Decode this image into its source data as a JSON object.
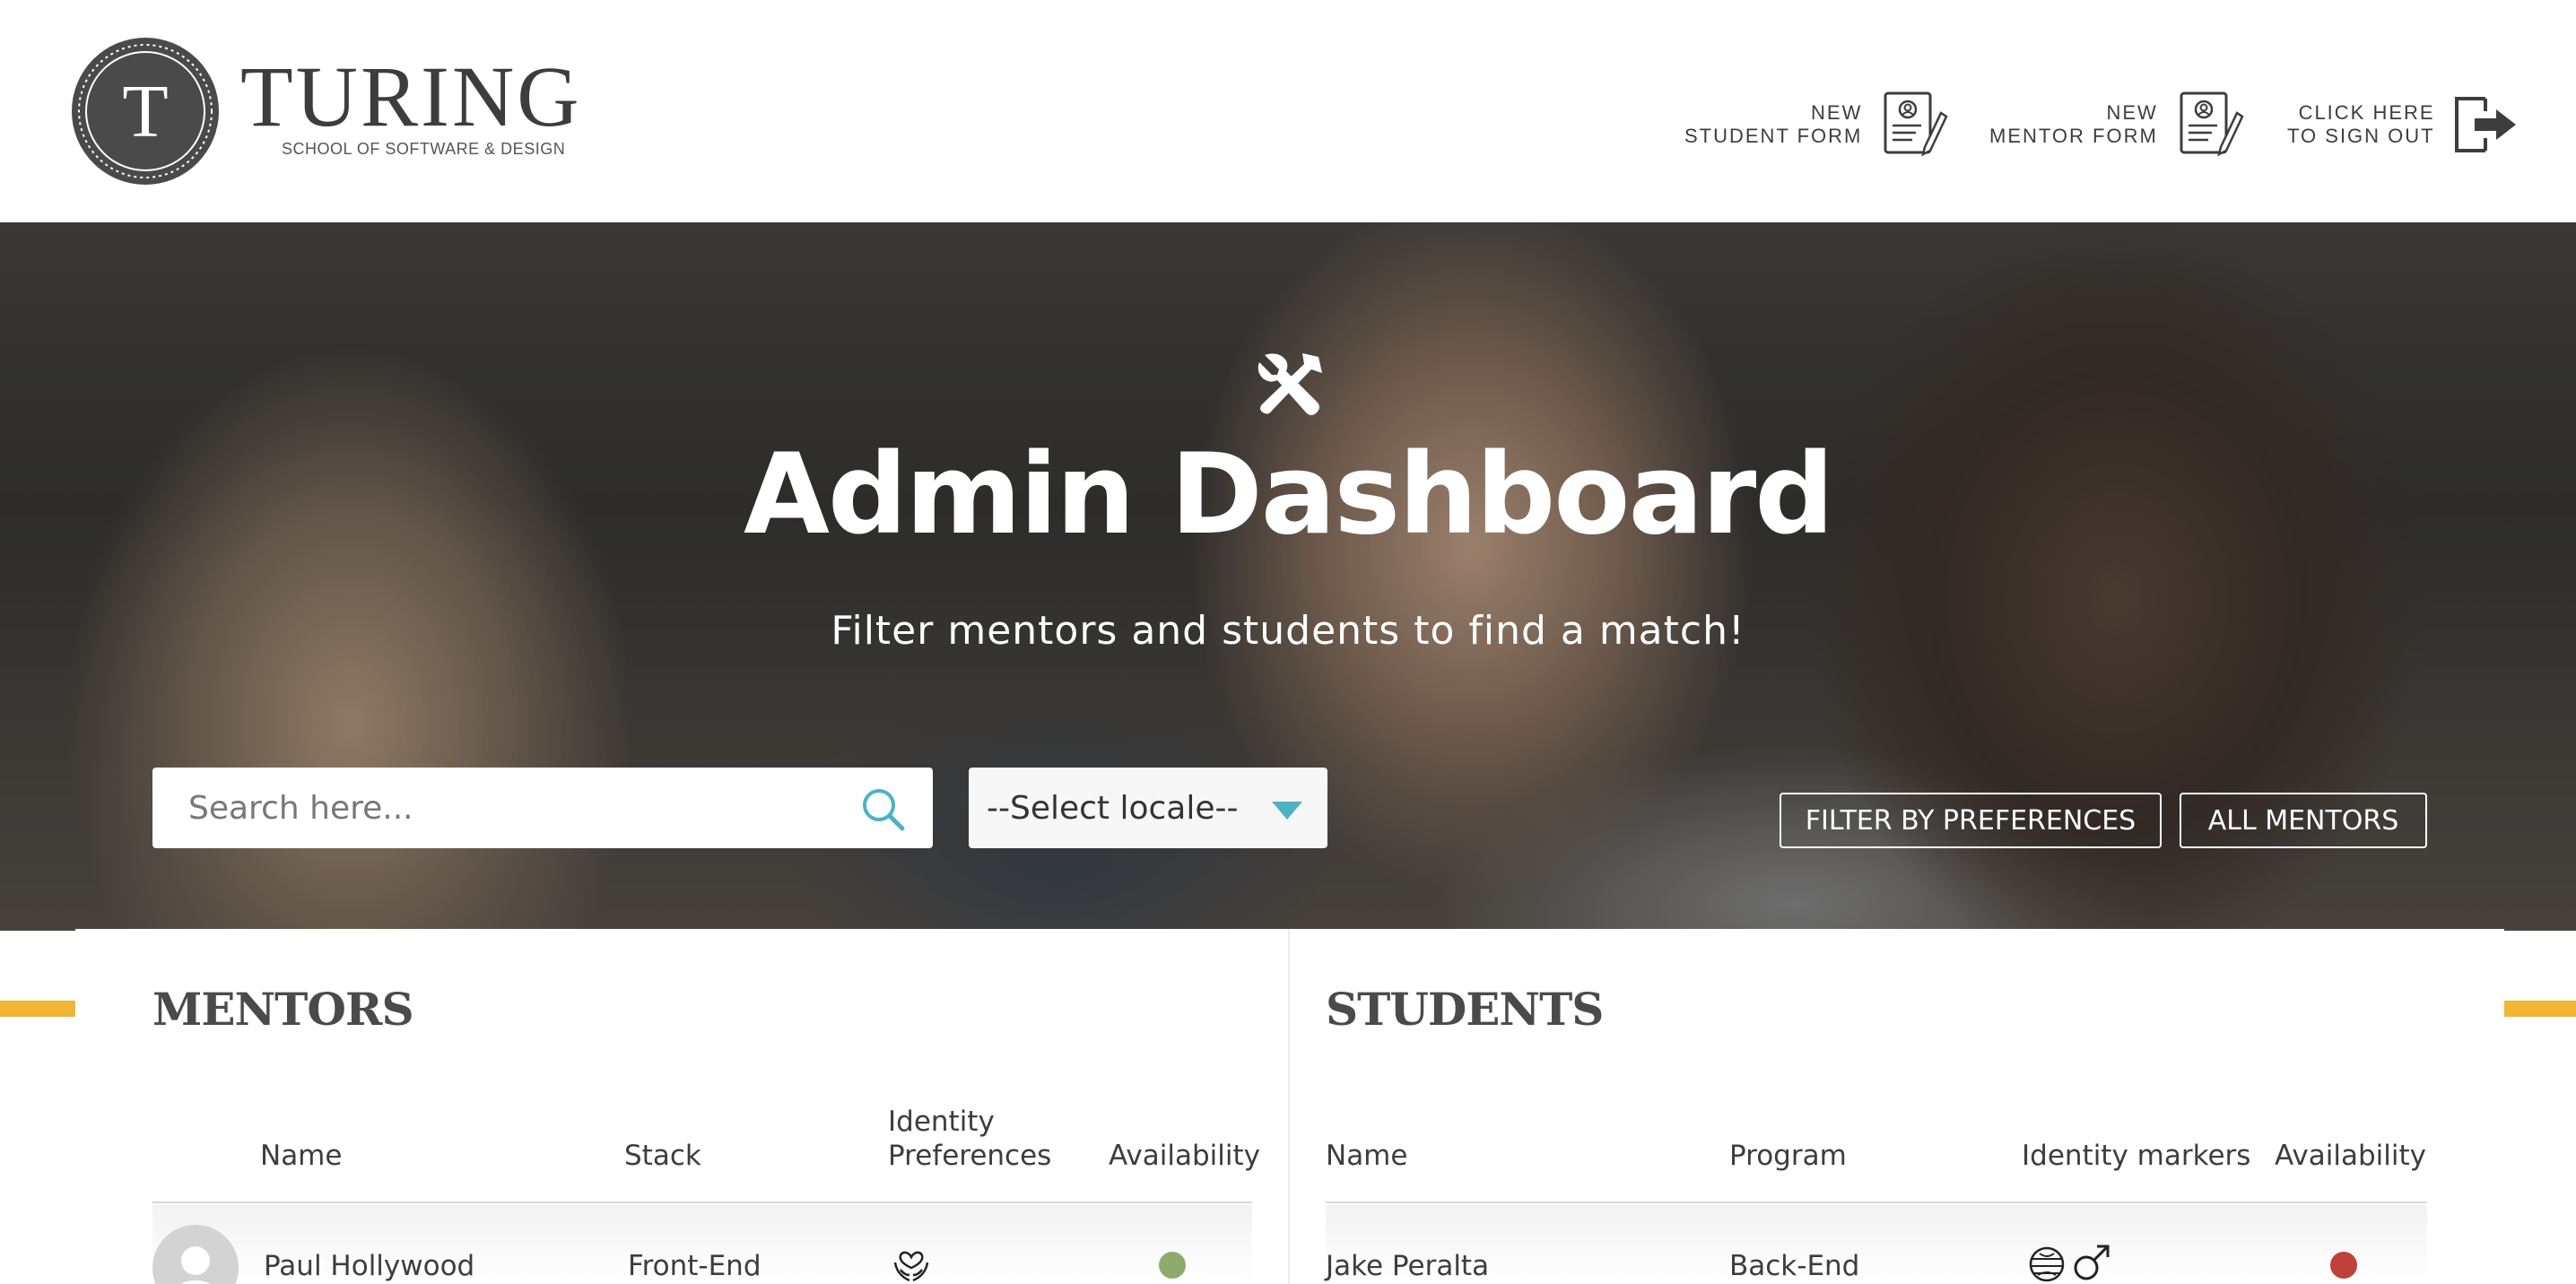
{
  "brand": {
    "logo_letter": "T",
    "name": "TURING",
    "tagline": "SCHOOL OF SOFTWARE & DESIGN"
  },
  "nav": [
    {
      "line1": "NEW",
      "line2": "STUDENT FORM",
      "icon": "form-icon"
    },
    {
      "line1": "NEW",
      "line2": "MENTOR FORM",
      "icon": "form-icon"
    },
    {
      "line1": "CLICK HERE",
      "line2": "TO SIGN OUT",
      "icon": "sign-out-icon"
    }
  ],
  "hero": {
    "icon": "tools-icon",
    "title": "Admin Dashboard",
    "subtitle": "Filter mentors and students to find a match!"
  },
  "search": {
    "placeholder": "Search here...",
    "value": ""
  },
  "locale": {
    "selected": "--Select locale--"
  },
  "buttons": {
    "filter": "FILTER BY PREFERENCES",
    "all_mentors": "ALL MENTORS"
  },
  "mentors": {
    "title": "MENTORS",
    "columns": [
      "Name",
      "Stack",
      "Identity",
      "Preferences",
      "Availability"
    ],
    "rows": [
      {
        "name": "Paul Hollywood",
        "stack": "Front-End",
        "preference_icon": "hands-heart-icon",
        "availability_color": "#8fab6b"
      }
    ]
  },
  "students": {
    "title": "STUDENTS",
    "columns": [
      "Name",
      "Program",
      "Identity markers",
      "Availability"
    ],
    "rows": [
      {
        "name": "Jake Peralta",
        "program": "Back-End",
        "marker_icons": [
          "globe-icon",
          "male-icon"
        ],
        "availability_color": "#c0403a"
      }
    ]
  },
  "colors": {
    "accent": "#f0b533",
    "search_icon": "#4ab3c4",
    "caret": "#4ab3c4"
  }
}
